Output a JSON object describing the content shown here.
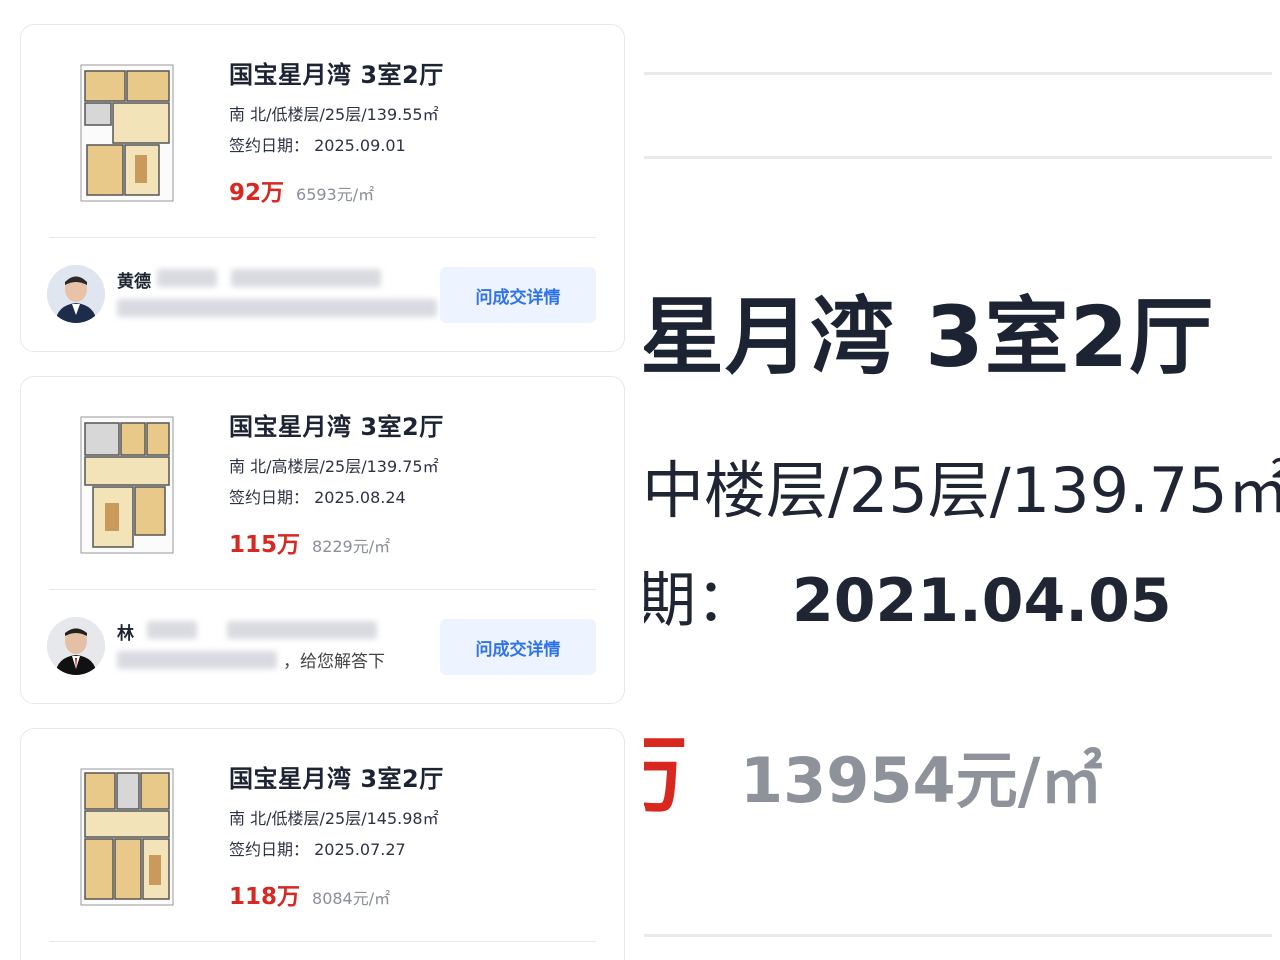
{
  "listings": [
    {
      "title": "国宝星月湾 3室2厅",
      "meta": "南 北/低楼层/25层/139.55㎡",
      "date_label": "签约日期：",
      "date": "2025.09.01",
      "price": "92万",
      "unit_price": "6593元/㎡",
      "agent_name": "黄德",
      "action": "问成交详情"
    },
    {
      "title": "国宝星月湾 3室2厅",
      "meta": "南 北/高楼层/25层/139.75㎡",
      "date_label": "签约日期：",
      "date": "2025.08.24",
      "price": "115万",
      "unit_price": "8229元/㎡",
      "agent_name": "林",
      "agent_note": "，给您解答下",
      "action": "问成交详情"
    },
    {
      "title": "国宝星月湾 3室2厅",
      "meta": "南 北/低楼层/25层/145.98㎡",
      "date_label": "签约日期：",
      "date": "2025.07.27",
      "price": "118万",
      "unit_price": "8084元/㎡"
    }
  ],
  "zoom": {
    "title": "星月湾 3室2厅",
    "meta": "中楼层/25层/139.75㎡",
    "date_label": "期：",
    "date": "2021.04.05",
    "price_fragment": "万",
    "unit_price": "13954元/㎡"
  }
}
